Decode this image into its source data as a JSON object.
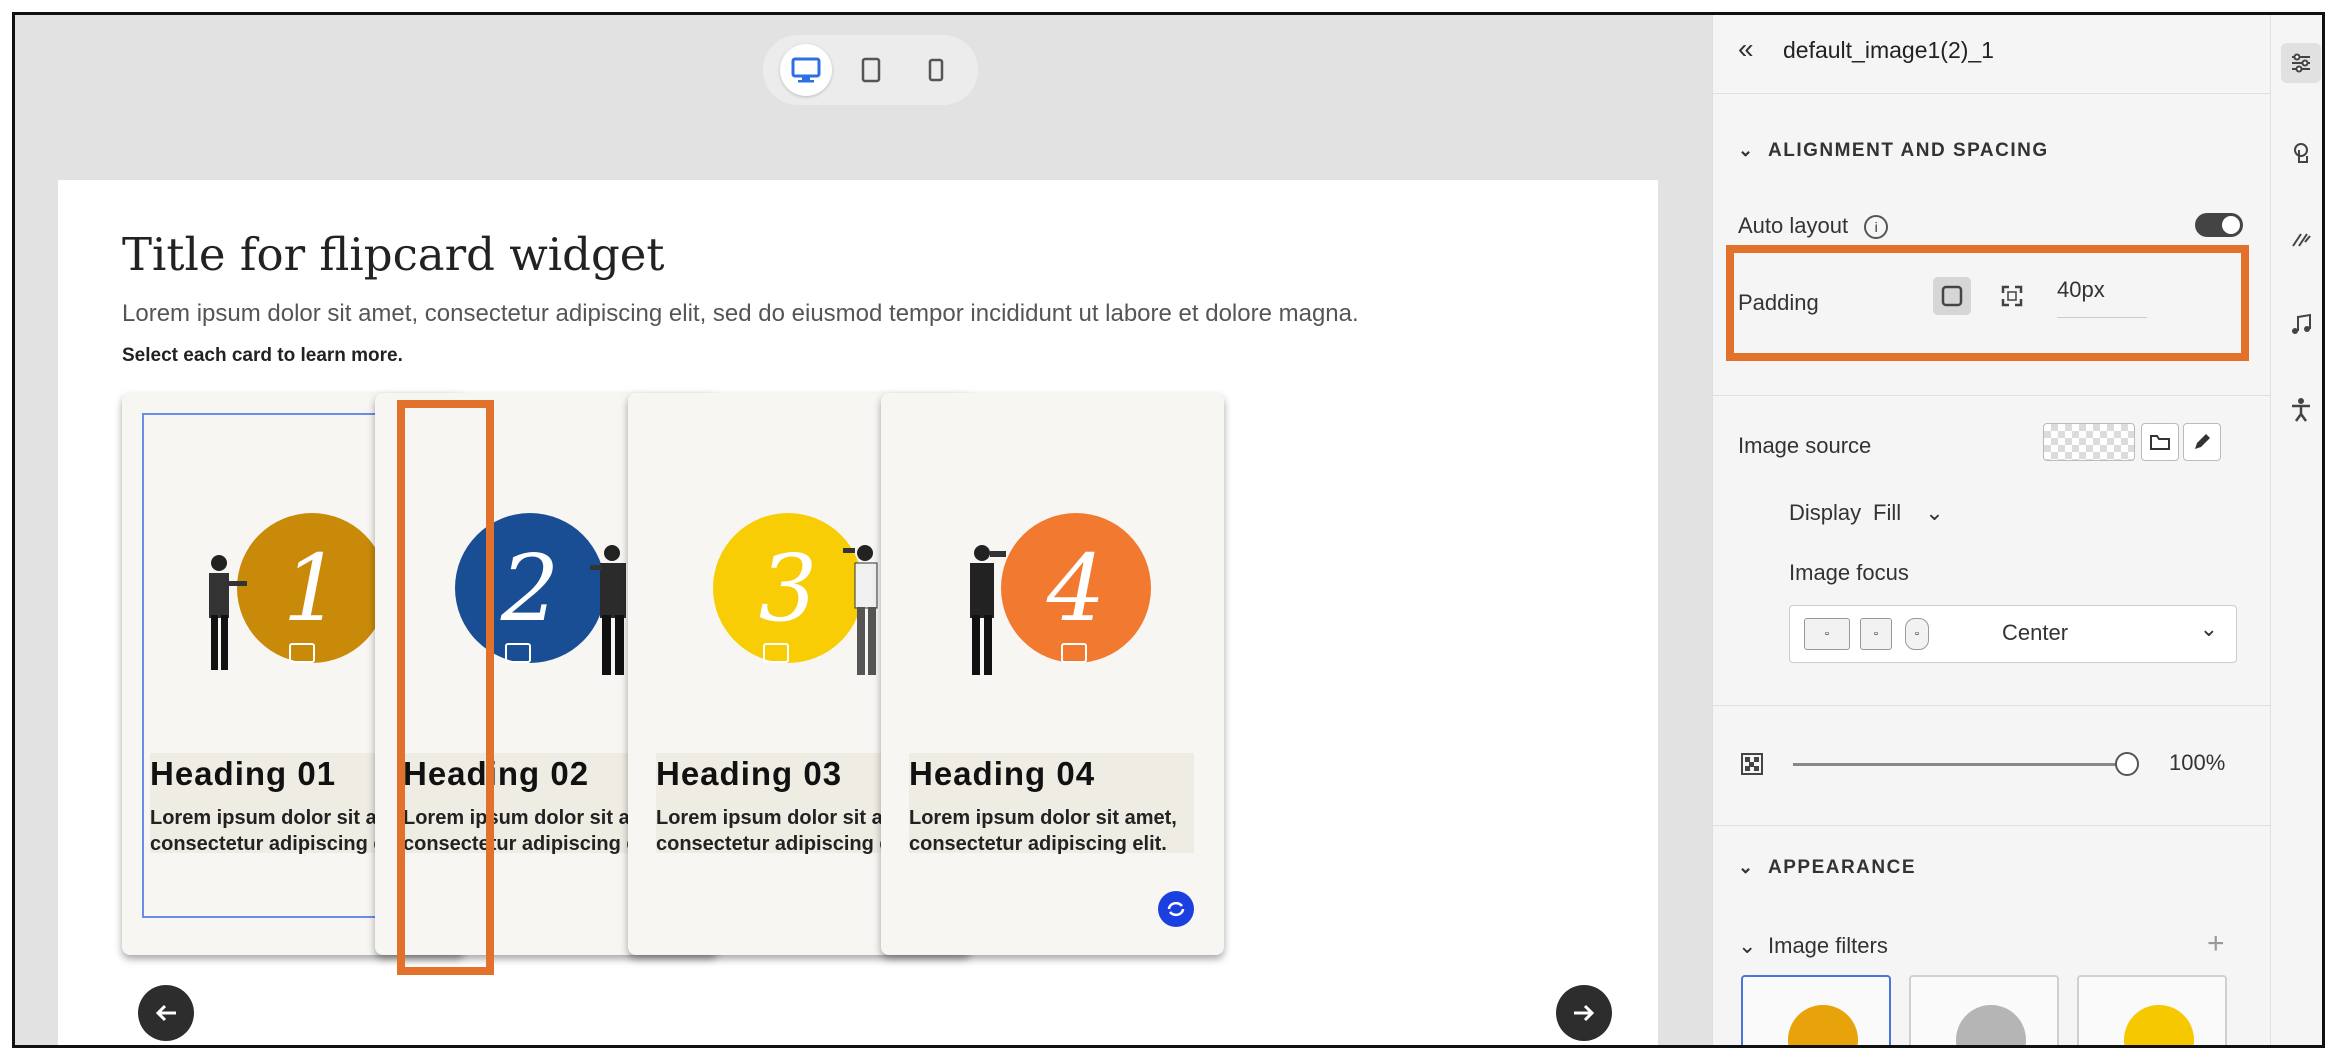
{
  "device_toggle": {
    "desktop_icon": "desktop-icon",
    "tablet_icon": "tablet-icon",
    "mobile_icon": "mobile-icon",
    "active": "desktop"
  },
  "page": {
    "title": "Title for flipcard widget",
    "description": "Lorem ipsum dolor sit amet, consectetur adipiscing elit, sed do eiusmod tempor incididunt ut labore et dolore magna.",
    "instruction": "Select each card to learn more."
  },
  "cards": [
    {
      "number": "1",
      "heading": "Heading 01",
      "text": "Lorem ipsum dolor sit amet, consectetur adipiscing elit.",
      "color": "#c98a0a"
    },
    {
      "number": "2",
      "heading": "Heading 02",
      "text": "Lorem ipsum dolor sit amet, consectetur adipiscing elit.",
      "color": "#1a4e94"
    },
    {
      "number": "3",
      "heading": "Heading 03",
      "text": "Lorem ipsum dolor sit amet, consectetur adipiscing elit.",
      "color": "#f8cd06"
    },
    {
      "number": "4",
      "heading": "Heading 04",
      "text": "Lorem ipsum dolor sit amet, consectetur adipiscing elit.",
      "color": "#f27a30"
    }
  ],
  "padding_tag": "40",
  "panel": {
    "title": "default_image1(2)_1",
    "alignment_section": "ALIGNMENT AND SPACING",
    "auto_layout_label": "Auto layout",
    "auto_layout_on": true,
    "padding_label": "Padding",
    "padding_value": "40px",
    "image_source_label": "Image source",
    "display_label": "Display",
    "display_value": "Fill",
    "image_focus_label": "Image focus",
    "image_focus_value": "Center",
    "opacity_value": "100%",
    "appearance_section": "APPEARANCE",
    "image_filters_label": "Image filters",
    "filter_thumbs": [
      "1",
      "1",
      "1"
    ]
  },
  "colors": {
    "accent_orange": "#e2712c",
    "flip_button": "#1c3fe0",
    "padding_highlight": "#f096f0"
  }
}
